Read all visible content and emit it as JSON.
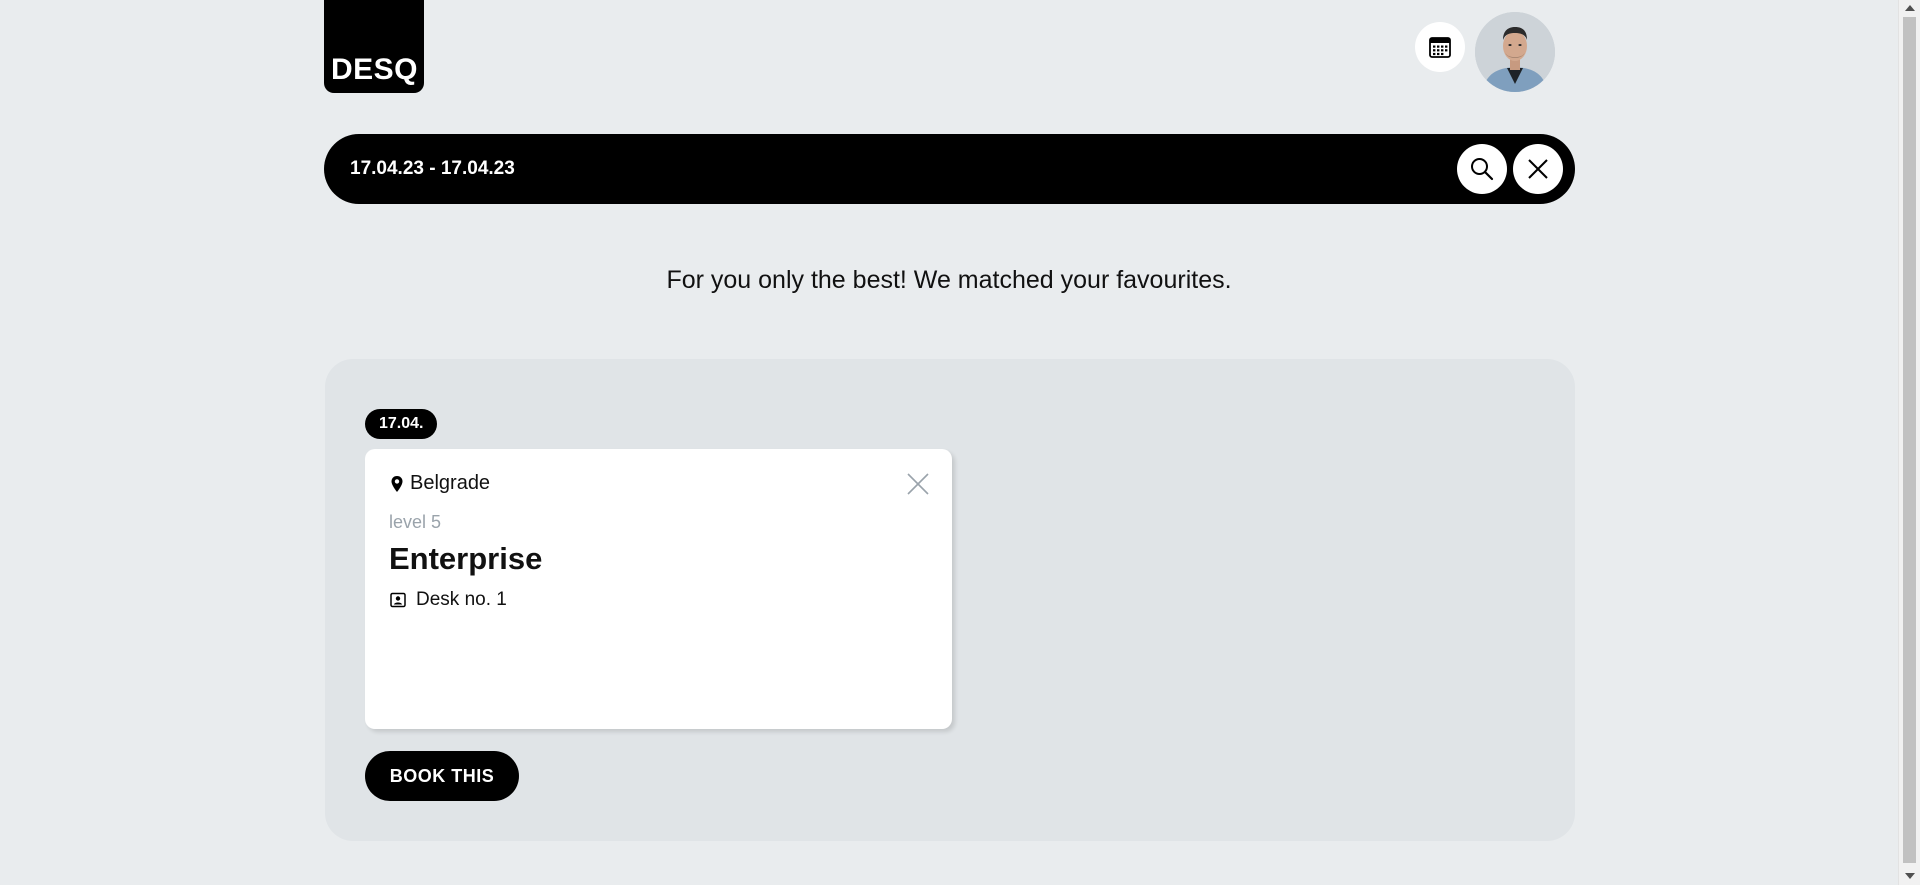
{
  "header": {
    "logo_text": "DESQ",
    "calendar_icon": "calendar-icon",
    "avatar_icon": "user-avatar"
  },
  "search": {
    "date_range": "17.04.23 - 17.04.23",
    "search_icon": "search-icon",
    "clear_icon": "close-icon"
  },
  "tagline": "For you only the best! We matched your favourites.",
  "results": {
    "groups": [
      {
        "date_label": "17.04.",
        "card": {
          "location": "Belgrade",
          "level": "level 5",
          "space_name": "Enterprise",
          "desk": "Desk no. 1",
          "location_icon": "map-pin-icon",
          "desk_icon": "desk-icon",
          "remove_icon": "close-icon"
        },
        "book_label": "BOOK THIS"
      }
    ]
  },
  "colors": {
    "background": "#e9ecee",
    "panel": "#e0e4e7",
    "primary": "#000000",
    "muted_text": "#9aa3ab"
  }
}
